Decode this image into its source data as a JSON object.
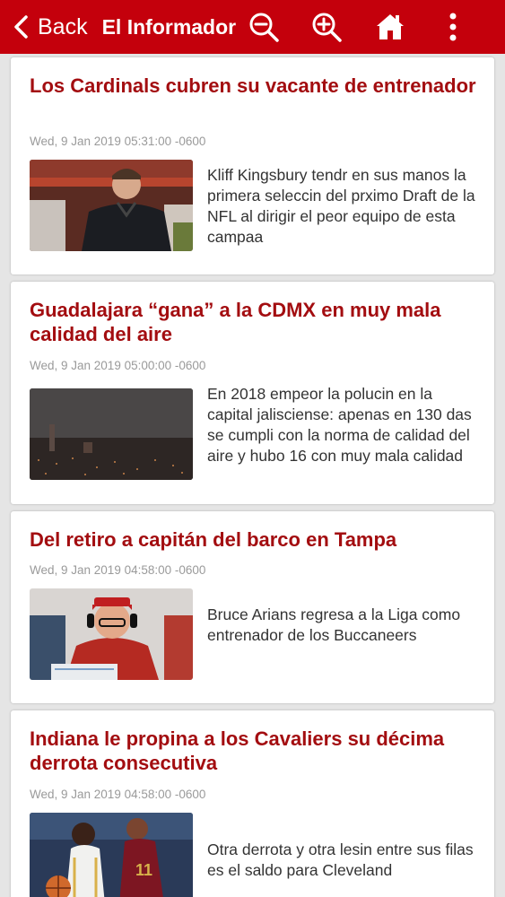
{
  "header": {
    "back_label": "Back",
    "title": "El Informador",
    "icons": [
      "chevron-left-icon",
      "zoom-out-icon",
      "zoom-in-icon",
      "home-icon",
      "more-vertical-icon"
    ],
    "colors": {
      "bar": "#c4000c",
      "title_text": "#a30d10"
    }
  },
  "articles": [
    {
      "title": "Los Cardinals cubren su vacante de entrenador",
      "date": "Wed, 9 Jan 2019 05:31:00 -0600",
      "summary": "Kliff Kingsbury tendr en sus manos la primera seleccin del prximo Draft de la NFL al dirigir el peor equipo de esta campaa"
    },
    {
      "title": "Guadalajara “gana” a la CDMX en muy mala calidad del aire",
      "date": "Wed, 9 Jan 2019 05:00:00 -0600",
      "summary": "En 2018 empeor la polucin en la capital jalisciense: apenas en 130 das se cumpli con la norma de calidad del aire y hubo 16 con muy mala calidad"
    },
    {
      "title": "Del retiro a capitán del barco en Tampa",
      "date": "Wed, 9 Jan 2019 04:58:00 -0600",
      "summary": "Bruce Arians regresa a la Liga como entrenador de los Buccaneers"
    },
    {
      "title": "Indiana le propina a los Cavaliers su décima derrota consecutiva",
      "date": "Wed, 9 Jan 2019 04:58:00 -0600",
      "summary": "Otra derrota y otra lesin entre sus filas es el saldo para Cleveland"
    }
  ]
}
